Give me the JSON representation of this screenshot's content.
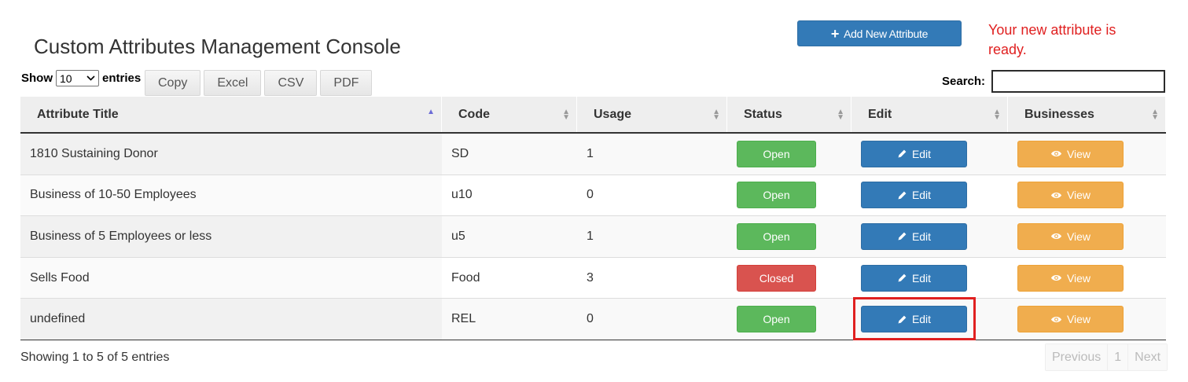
{
  "header": {
    "title": "Custom Attributes Management Console",
    "add_button_label": "Add New Attribute",
    "flash_message": "Your new attribute is ready."
  },
  "controls": {
    "show_label": "Show",
    "entries_label": "entries",
    "page_length_value": "10",
    "export_buttons": [
      "Copy",
      "Excel",
      "CSV",
      "PDF"
    ],
    "search_label": "Search:",
    "search_value": ""
  },
  "table": {
    "columns": [
      "Attribute Title",
      "Code",
      "Usage",
      "Status",
      "Edit",
      "Businesses"
    ],
    "sorted_column": "Attribute Title",
    "sort_direction": "ascending",
    "edit_label": "Edit",
    "view_label": "View",
    "rows": [
      {
        "title": "1810 Sustaining Donor",
        "code": "SD",
        "usage": "1",
        "status": "Open"
      },
      {
        "title": "Business of 10-50 Employees",
        "code": "u10",
        "usage": "0",
        "status": "Open"
      },
      {
        "title": "Business of 5 Employees or less",
        "code": "u5",
        "usage": "1",
        "status": "Open"
      },
      {
        "title": "Sells Food",
        "code": "Food",
        "usage": "3",
        "status": "Closed"
      },
      {
        "title": "undefined",
        "code": "REL",
        "usage": "0",
        "status": "Open"
      }
    ]
  },
  "footer": {
    "info": "Showing 1 to 5 of 5 entries",
    "pagination": {
      "previous": "Previous",
      "current_page": "1",
      "next": "Next"
    }
  },
  "colors": {
    "primary": "#337ab7",
    "success": "#5cb85c",
    "danger": "#d9534f",
    "warning": "#f0ad4e",
    "flash": "#e02020",
    "highlight": "#e02020"
  },
  "icons": {
    "add": "plus-icon",
    "edit": "pencil-icon",
    "view": "eye-icon",
    "sort": "sort-icon",
    "dropdown": "chevron-down-icon"
  }
}
